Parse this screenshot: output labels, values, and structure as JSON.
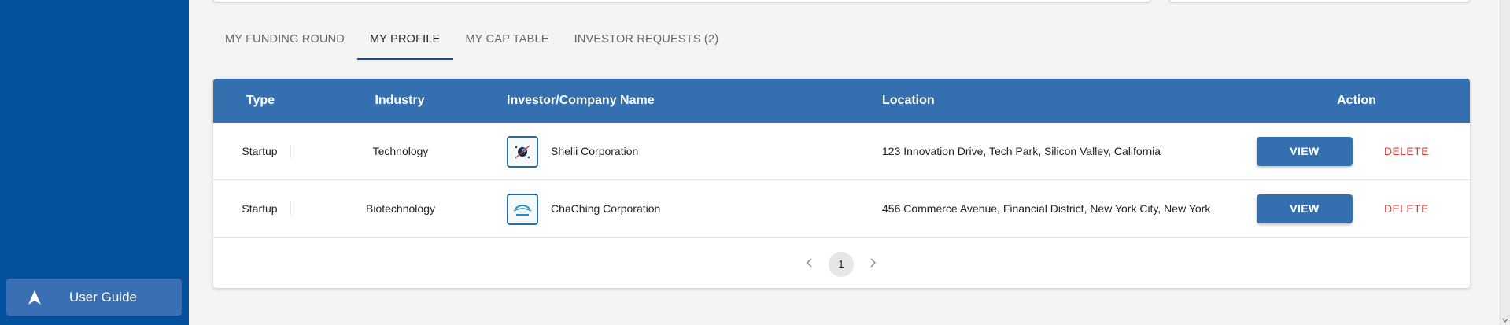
{
  "sidebar": {
    "user_guide_label": "User Guide",
    "user_guide_icon": "navigation-arrow-icon"
  },
  "tabs": [
    {
      "label": "MY FUNDING ROUND",
      "active": false
    },
    {
      "label": "MY PROFILE",
      "active": true
    },
    {
      "label": "MY CAP TABLE",
      "active": false
    },
    {
      "label": "INVESTOR REQUESTS (2)",
      "active": false
    }
  ],
  "table": {
    "headers": {
      "type": "Type",
      "industry": "Industry",
      "name": "Investor/Company Name",
      "location": "Location",
      "action": "Action"
    },
    "rows": [
      {
        "type": "Startup",
        "industry": "Technology",
        "name": "Shelli Corporation",
        "logo": "shelli-logo-icon",
        "location": "123 Innovation Drive, Tech Park, Silicon Valley, California",
        "view_label": "VIEW",
        "delete_label": "DELETE"
      },
      {
        "type": "Startup",
        "industry": "Biotechnology",
        "name": "ChaChing Corporation",
        "logo": "chaching-logo-icon",
        "location": "456 Commerce Avenue, Financial District, New York City, New York",
        "view_label": "VIEW",
        "delete_label": "DELETE"
      }
    ]
  },
  "pagination": {
    "current_page": "1"
  },
  "colors": {
    "sidebar": "#03509f",
    "header": "#346faf",
    "delete": "#e53935"
  }
}
